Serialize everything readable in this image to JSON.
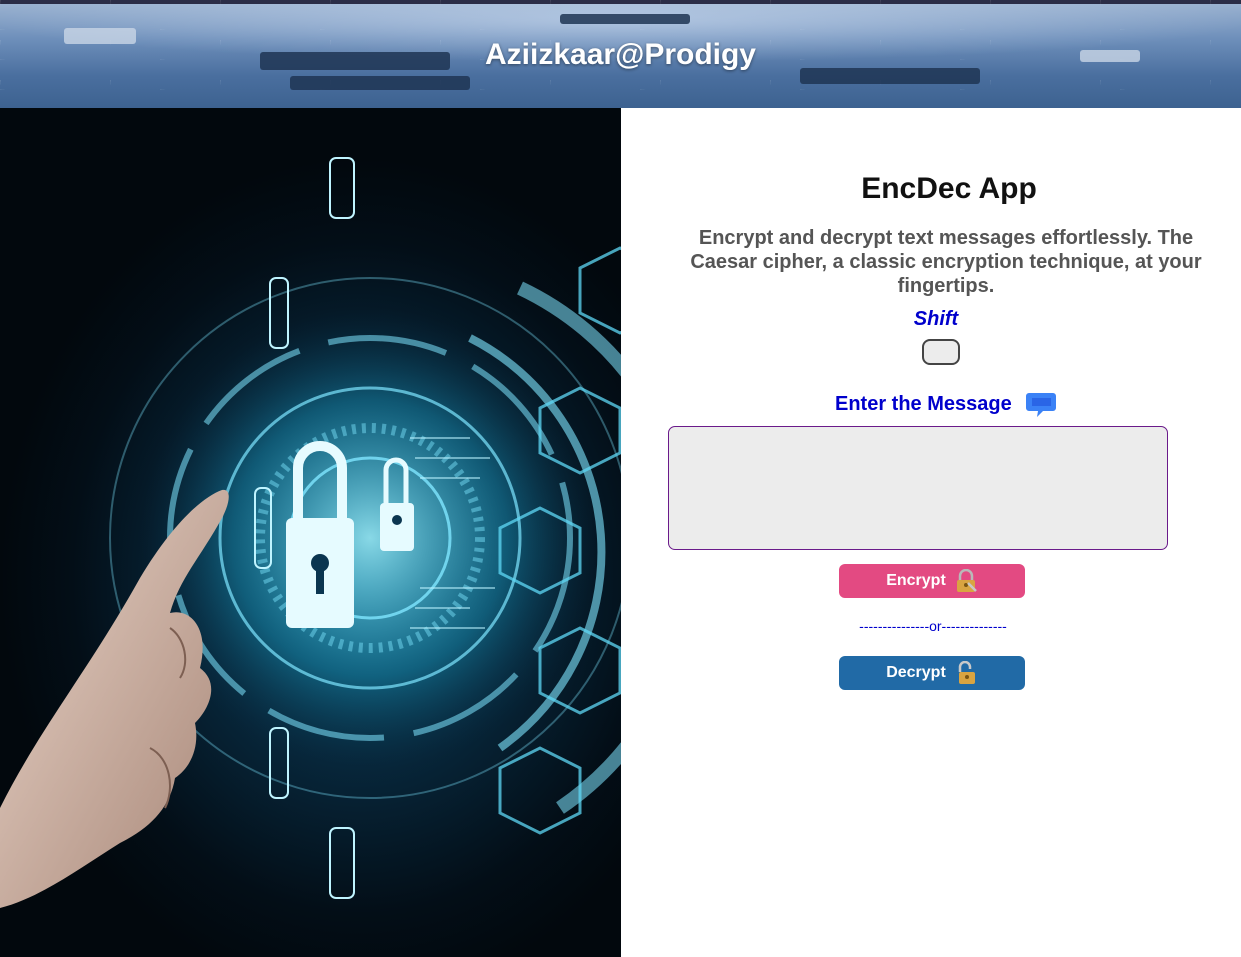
{
  "header": {
    "title": "Aziizkaar@Prodigy"
  },
  "app": {
    "title": "EncDec App",
    "description": "Encrypt and decrypt text messages effortlessly. The Caesar cipher, a classic encryption technique, at your fingertips.",
    "shift": {
      "label": "Shift",
      "value": ""
    },
    "message": {
      "label": "Enter the Message",
      "value": "",
      "placeholder": ""
    },
    "encrypt_label": "Encrypt",
    "separator": "---------------or--------------",
    "decrypt_label": "Decrypt"
  },
  "icons": {
    "message_icon": "chat-bubble-icon",
    "encrypt_icon": "lock-with-key-icon",
    "decrypt_icon": "open-lock-icon",
    "hero_image": "digital-padlock-hand-image"
  },
  "colors": {
    "accent_text": "#0000cc",
    "encrypt_button": "#e34a82",
    "decrypt_button": "#216aa6",
    "textarea_border": "#6a1a8a",
    "input_bg": "#ececec"
  }
}
